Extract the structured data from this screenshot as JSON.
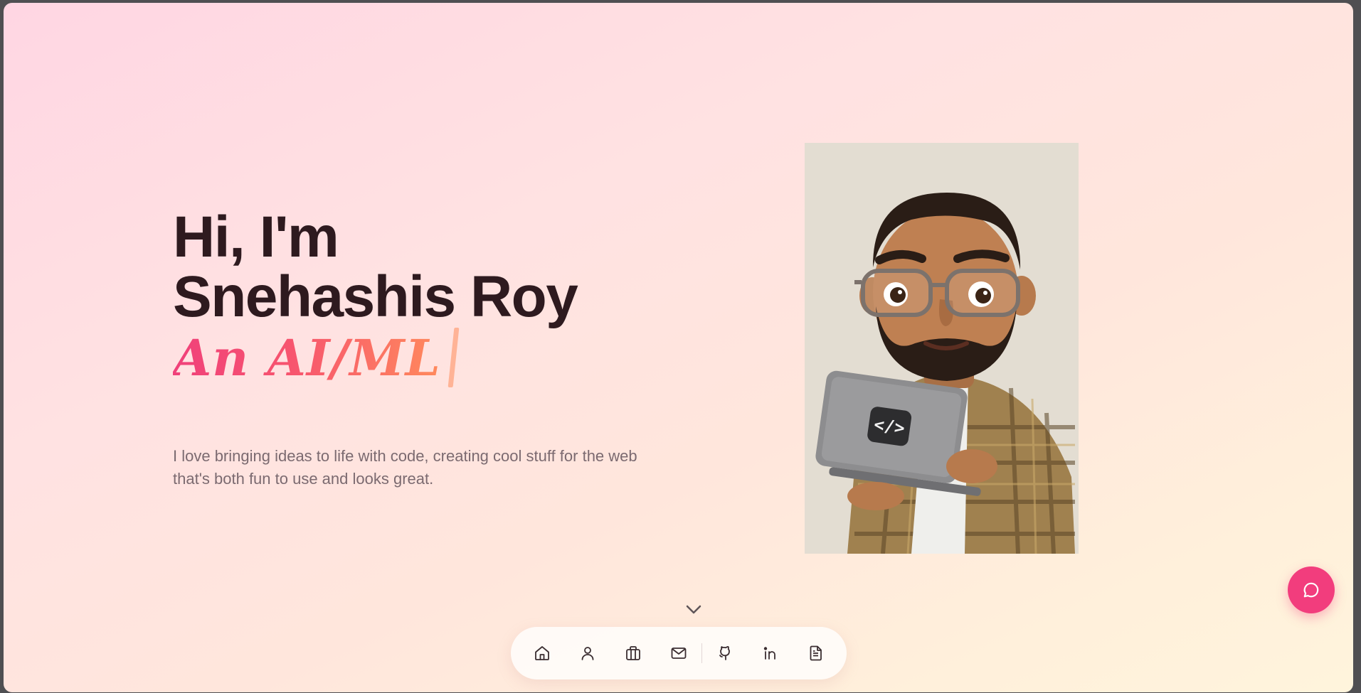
{
  "hero": {
    "greeting": "Hi, I'm",
    "name": "Snehashis Roy",
    "typed_role": "An AI/ML"
  },
  "bio": "I love bringing ideas to life with code, creating cool stuff for the web that's both fun to use and looks great.",
  "avatar": {
    "laptop_glyph": "</>"
  },
  "dock": {
    "items": [
      {
        "icon": "home-icon"
      },
      {
        "icon": "user-icon"
      },
      {
        "icon": "briefcase-icon"
      },
      {
        "icon": "mail-icon"
      },
      {
        "icon": "github-icon"
      },
      {
        "icon": "linkedin-icon"
      },
      {
        "icon": "document-icon"
      }
    ]
  },
  "colors": {
    "heading": "#2e1a1f",
    "accent_start": "#f0407a",
    "accent_end": "#ff8a5c",
    "fab": "#f23d7d",
    "bio_text": "#7b6a70"
  }
}
